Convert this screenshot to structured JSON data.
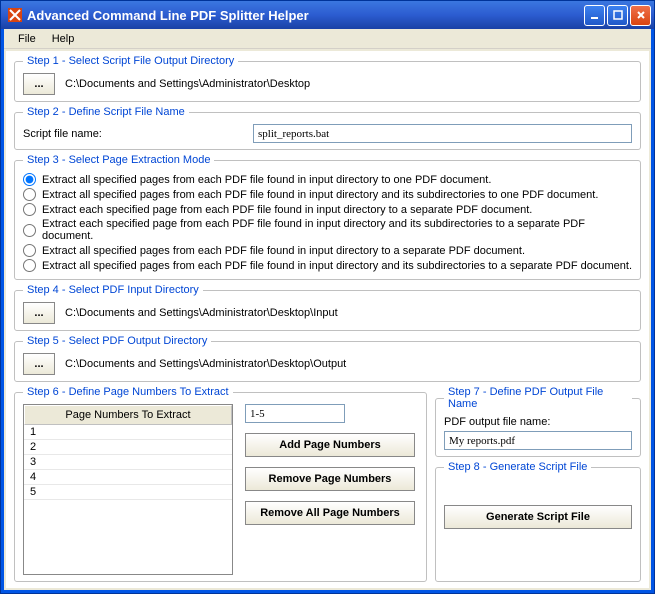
{
  "titlebar": {
    "text": "Advanced Command Line PDF Splitter Helper"
  },
  "menu": {
    "file": "File",
    "help": "Help"
  },
  "step1": {
    "legend": "Step 1 - Select Script File Output Directory",
    "browse": "...",
    "path": "C:\\Documents and Settings\\Administrator\\Desktop"
  },
  "step2": {
    "legend": "Step 2 - Define Script File Name",
    "label": "Script file name:",
    "value": "split_reports.bat"
  },
  "step3": {
    "legend": "Step 3 - Select Page Extraction Mode",
    "options": [
      "Extract all specified pages from each PDF file found in input directory to one PDF document.",
      "Extract all specified pages from each PDF file found in input directory and its subdirectories to one PDF document.",
      "Extract each specified page from each PDF file found in input directory to a separate PDF document.",
      "Extract each specified page from each PDF file found in input directory and its subdirectories to a separate PDF document.",
      "Extract all specified pages from each PDF file found in input directory to a separate PDF document.",
      "Extract all specified pages from each PDF file found in input directory and its subdirectories to a separate PDF document."
    ],
    "selected": 0
  },
  "step4": {
    "legend": "Step 4 - Select PDF Input Directory",
    "browse": "...",
    "path": "C:\\Documents and Settings\\Administrator\\Desktop\\Input"
  },
  "step5": {
    "legend": "Step 5 - Select PDF Output Directory",
    "browse": "...",
    "path": "C:\\Documents and Settings\\Administrator\\Desktop\\Output"
  },
  "step6": {
    "legend": "Step 6 - Define Page Numbers To Extract",
    "list_header": "Page Numbers To Extract",
    "rows": [
      "1",
      "2",
      "3",
      "4",
      "5"
    ],
    "input_value": "1-5",
    "add": "Add Page Numbers",
    "remove": "Remove Page Numbers",
    "remove_all": "Remove All Page Numbers"
  },
  "step7": {
    "legend": "Step 7 - Define PDF Output File Name",
    "label": "PDF output file name:",
    "value": "My reports.pdf"
  },
  "step8": {
    "legend": "Step 8 - Generate Script File",
    "generate": "Generate Script File"
  }
}
